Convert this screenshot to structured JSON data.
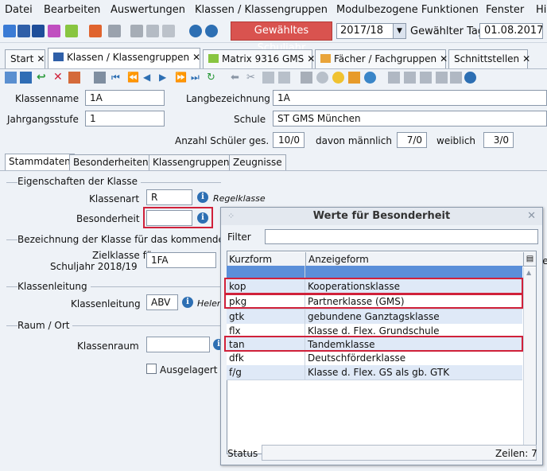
{
  "menu": [
    "Datei",
    "Bearbeiten",
    "Auswertungen",
    "Klassen / Klassengruppen",
    "Modulbezogene Funktionen",
    "Fenster",
    "Hi"
  ],
  "toolbar": {
    "schuljahr_button": "Gewähltes Schuljahr",
    "schuljahr_value": "2017/18",
    "tag_label": "Gewählter Tag",
    "tag_value": "01.08.2017"
  },
  "tabs": [
    "Start",
    "Klassen / Klassengruppen",
    "Matrix 9316 GMS",
    "Fächer / Fachgruppen",
    "Schnittstellen"
  ],
  "form": {
    "klassenname_label": "Klassenname",
    "klassenname_value": "1A",
    "langbezeichnung_label": "Langbezeichnung",
    "langbezeichnung_value": "1A",
    "jahrgangsstufe_label": "Jahrgangsstufe",
    "jahrgangsstufe_value": "1",
    "schule_label": "Schule",
    "schule_value": "ST GMS München",
    "anzahl_label": "Anzahl Schüler ges.",
    "anzahl_value": "10/0",
    "maennlich_label": "davon männlich",
    "maennlich_value": "7/0",
    "weiblich_label": "weiblich",
    "weiblich_value": "3/0"
  },
  "subtabs": [
    "Stammdaten",
    "Besonderheiten",
    "Klassengruppen",
    "Zeugnisse"
  ],
  "stammdaten": {
    "eigenschaften_title": "Eigenschaften der Klasse",
    "klassenart_label": "Klassenart",
    "klassenart_value": "R",
    "klassenart_hint": "Regelklasse",
    "besonderheit_label": "Besonderheit",
    "besonderheit_value": "",
    "bezeichnung_title": "Bezeichnung der Klasse für das kommende S",
    "zielklasse_label_1": "Zielklasse für",
    "zielklasse_label_2": "Schuljahr 2018/19",
    "zielklasse_value": "1FA",
    "klassenleitung_title": "Klassenleitung",
    "klassenleitung_label": "Klassenleitung",
    "klassenleitung_value": "ABV",
    "klassenleitung_hint": "Helen",
    "raum_title": "Raum / Ort",
    "klassenraum_label": "Klassenraum",
    "klassenraum_value": "",
    "ausgelagert_label": "Ausgelagert",
    "right_cut": "fe"
  },
  "dialog": {
    "title": "Werte für Besonderheit",
    "filter_label": "Filter",
    "filter_value": "",
    "col1": "Kurzform",
    "col2": "Anzeigeform",
    "rows": [
      {
        "k": "",
        "a": ""
      },
      {
        "k": "kop",
        "a": "Kooperationsklasse"
      },
      {
        "k": "pkg",
        "a": "Partnerklasse (GMS)"
      },
      {
        "k": "gtk",
        "a": "gebundene Ganztagsklasse"
      },
      {
        "k": "flx",
        "a": "Klasse d. Flex. Grundschule"
      },
      {
        "k": "tan",
        "a": "Tandemklasse"
      },
      {
        "k": "dfk",
        "a": "Deutschförderklasse"
      },
      {
        "k": "f/g",
        "a": "Klasse d. Flex. GS als gb. GTK"
      }
    ],
    "status_label": "Status",
    "zeilen": "Zeilen: 7"
  },
  "colors": {
    "accent_red": "#d9534f",
    "highlight_red": "#d0213a",
    "row_selected": "#5b8fd9",
    "row_alt": "#dfe9f7"
  }
}
